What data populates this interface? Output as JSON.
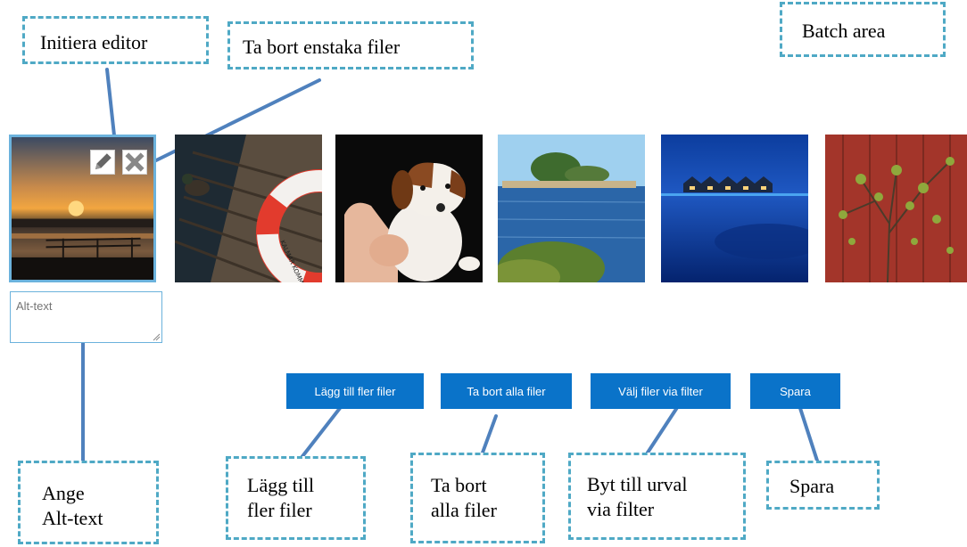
{
  "callouts": {
    "initiera": "Initiera editor",
    "ta_bort_enstaka": "Ta bort enstaka filer",
    "batch_area": "Batch area",
    "ange_alt": "Ange\nAlt-text",
    "lagg_till": "Lägg till\nfler filer",
    "ta_bort_alla": "Ta bort\nalla filer",
    "byt_urval": "Byt till urval\nvia filter",
    "spara": "Spara"
  },
  "alt_text": {
    "placeholder": "Alt-text"
  },
  "buttons": {
    "add_more": "Lägg till fler filer",
    "remove_all": "Ta bort alla filer",
    "select_filter": "Välj filer via filter",
    "save": "Spara"
  },
  "images": [
    "sunset",
    "duck-lifebuoy",
    "puppy",
    "island",
    "water-villas",
    "tree-red-wall"
  ],
  "lifebuoy_text": "KALMAR KOMMUN",
  "colors": {
    "accent": "#0a73c9",
    "callout_border": "#4fa9c5",
    "connector": "#4f81bd",
    "selection": "#6bb2dc"
  }
}
